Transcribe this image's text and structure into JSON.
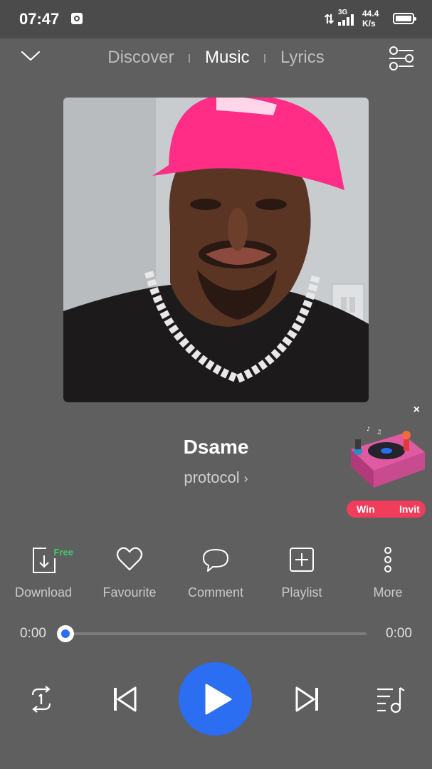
{
  "status_bar": {
    "time": "07:47",
    "network": "3G",
    "speed_value": "44.4",
    "speed_unit": "K/s"
  },
  "nav": {
    "tabs": [
      {
        "label": "Discover",
        "active": false
      },
      {
        "label": "Music",
        "active": true
      },
      {
        "label": "Lyrics",
        "active": false
      }
    ]
  },
  "song": {
    "title": "Dsame",
    "artist": "protocol"
  },
  "promo": {
    "badge_left": "Win",
    "badge_right": "Invit"
  },
  "actions": {
    "download": {
      "label": "Download",
      "tag": "Free",
      "icon": "download-icon"
    },
    "favourite": {
      "label": "Favourite",
      "icon": "heart-icon"
    },
    "comment": {
      "label": "Comment",
      "icon": "comment-icon"
    },
    "playlist": {
      "label": "Playlist",
      "icon": "add-to-playlist-icon"
    },
    "more": {
      "label": "More",
      "icon": "more-vertical-icon"
    }
  },
  "player": {
    "current_time": "0:00",
    "duration": "0:00",
    "progress_fraction": 0
  },
  "colors": {
    "background": "#5f5f5f",
    "accent": "#2b6ef1",
    "free_tag": "#3ecb6f",
    "promo_badge": "#ef3d5b",
    "cap_pink": "#ff2d86"
  }
}
